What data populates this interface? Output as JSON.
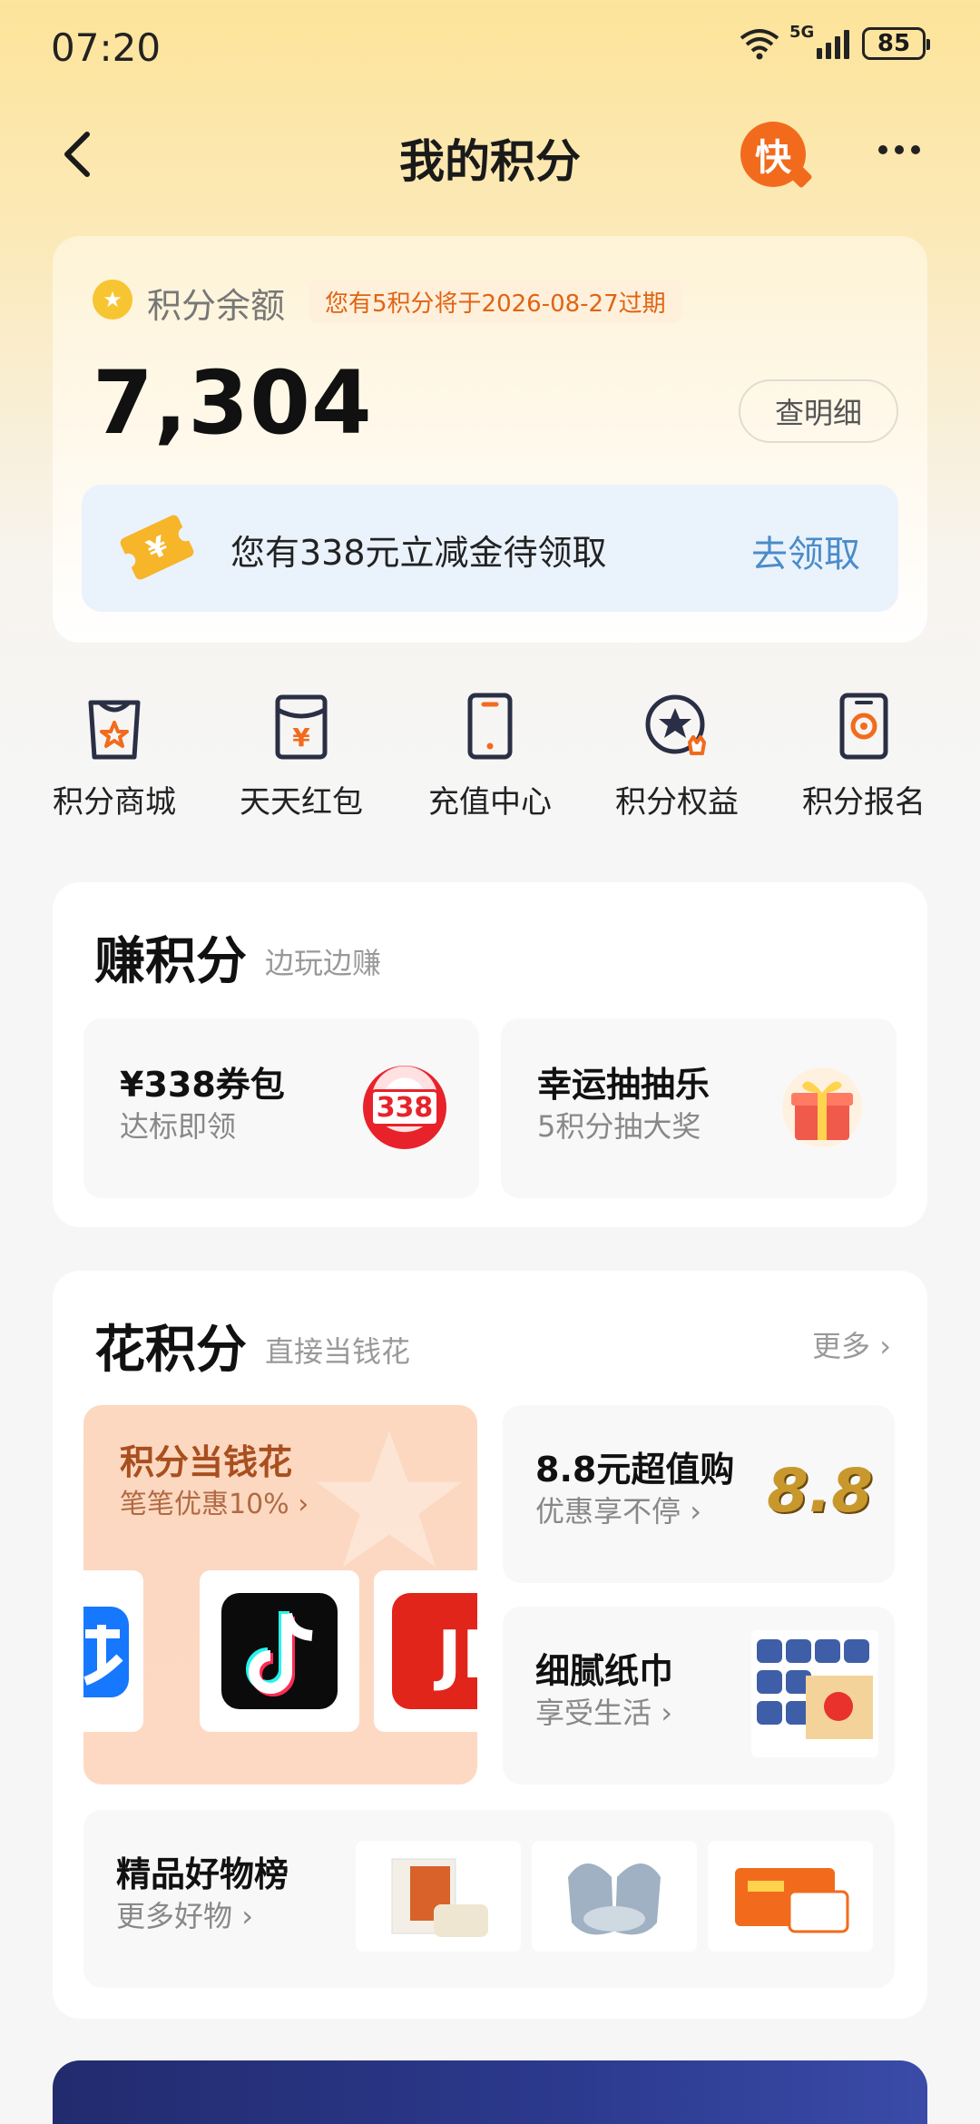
{
  "status_bar": {
    "time": "07:20",
    "network": "5G",
    "battery": "85"
  },
  "header": {
    "title": "我的积分",
    "badge_label": "快"
  },
  "points": {
    "label": "积分余额",
    "expiry_notice": "您有5积分将于2026-08-27过期",
    "value": "7,304",
    "detail_button": "查明细",
    "coupon_text": "您有338元立减金待领取",
    "coupon_link": "去领取"
  },
  "quick_nav": [
    {
      "label": "积分商城",
      "icon": "shopping-bag-icon"
    },
    {
      "label": "天天红包",
      "icon": "red-envelope-icon"
    },
    {
      "label": "充值中心",
      "icon": "phone-icon"
    },
    {
      "label": "积分权益",
      "icon": "star-badge-icon"
    },
    {
      "label": "积分报名",
      "icon": "signup-icon"
    }
  ],
  "earn": {
    "title": "赚积分",
    "subtitle": "边玩边赚",
    "cards": [
      {
        "title": "¥338券包",
        "subtitle": "达标即领",
        "badge": "338"
      },
      {
        "title": "幸运抽抽乐",
        "subtitle": "5积分抽大奖"
      }
    ]
  },
  "spend": {
    "title": "花积分",
    "subtitle": "直接当钱花",
    "more": "更多",
    "feature": {
      "title": "积分当钱花",
      "subtitle": "笔笔优惠10%"
    },
    "apps": [
      "alipay-logo",
      "douyin-logo",
      "jd-logo"
    ],
    "card_88": {
      "title": "8.8元超值购",
      "subtitle": "优惠享不停",
      "badge": "8.8"
    },
    "card_tissue": {
      "title": "细腻纸巾",
      "subtitle": "享受生活"
    },
    "ranking": {
      "title": "精品好物榜",
      "subtitle": "更多好物"
    }
  },
  "colors": {
    "accent": "#e06413",
    "link": "#4a8cc9",
    "brand_orange": "#f26b1d"
  }
}
